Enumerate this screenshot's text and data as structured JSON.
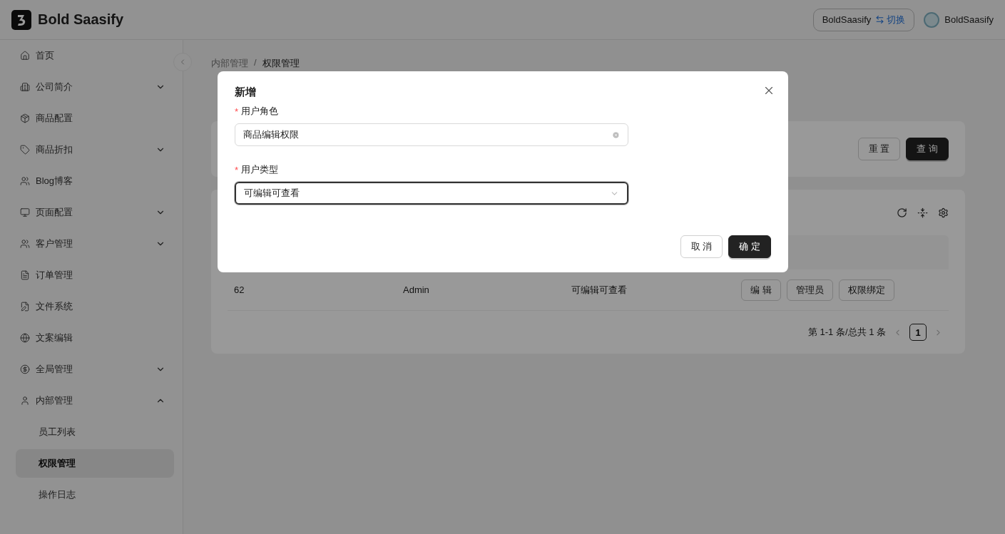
{
  "header": {
    "brand": "Bold Saasify",
    "account_switch": {
      "name": "BoldSaasify",
      "action": "切换"
    },
    "user": "BoldSaasify"
  },
  "sidebar": {
    "items": [
      {
        "label": "首页",
        "selected": false
      },
      {
        "label": "公司简介",
        "selected": false,
        "expanded": false
      },
      {
        "label": "商品配置",
        "selected": false
      },
      {
        "label": "商品折扣",
        "selected": false,
        "expanded": false
      },
      {
        "label": "Blog博客",
        "selected": false
      },
      {
        "label": "页面配置",
        "selected": false,
        "expanded": false
      },
      {
        "label": "客户管理",
        "selected": false,
        "expanded": false
      },
      {
        "label": "订单管理",
        "selected": false
      },
      {
        "label": "文件系统",
        "selected": false
      },
      {
        "label": "文案编辑",
        "selected": false
      },
      {
        "label": "全局管理",
        "selected": false,
        "expanded": false
      },
      {
        "label": "内部管理",
        "selected": false,
        "expanded": true,
        "children": [
          {
            "label": "员工列表",
            "selected": false
          },
          {
            "label": "权限管理",
            "selected": true
          },
          {
            "label": "操作日志",
            "selected": false
          }
        ]
      }
    ]
  },
  "breadcrumb": {
    "separator": "/",
    "items": [
      "内部管理",
      "权限管理"
    ]
  },
  "search_actions": [
    "重 置",
    "查 询"
  ],
  "table": {
    "rows": [
      {
        "cells": [
          "62",
          "Admin",
          "可编辑可查看"
        ],
        "actions": [
          "编 辑",
          "管理员",
          "权限绑定"
        ]
      }
    ],
    "pagination": {
      "summary": "第 1-1 条/总共 1 条",
      "pages": [
        {
          "label": "1",
          "selected": true
        }
      ]
    }
  },
  "dialog": {
    "title": "新增",
    "fields": [
      {
        "kind": "input",
        "label": "用户角色",
        "required_mark": "*",
        "value": "商品编辑权限",
        "focused": false
      },
      {
        "kind": "select",
        "label": "用户类型",
        "required_mark": "*",
        "value": "可编辑可查看",
        "focused": true
      }
    ],
    "buttons": [
      {
        "label": "取 消",
        "primary": false
      },
      {
        "label": "确 定",
        "primary": true
      }
    ]
  }
}
